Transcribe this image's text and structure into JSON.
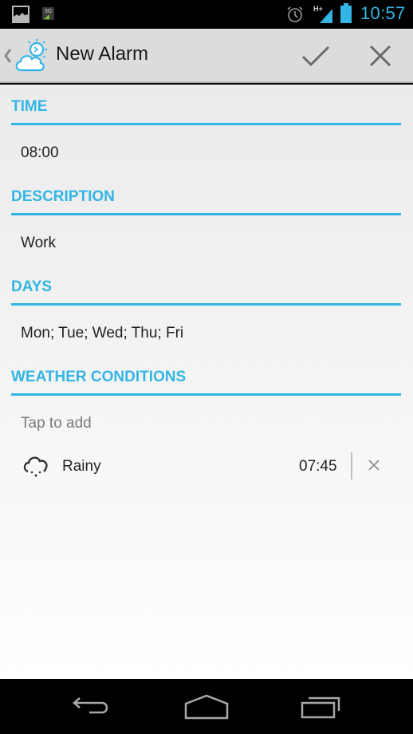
{
  "status_bar": {
    "icons": [
      "gallery-notification-icon",
      "3g-data-icon",
      "alarm-icon",
      "signal-hplus-icon",
      "battery-icon"
    ],
    "network_label": "H+",
    "data_label": "3G",
    "time": "10:57",
    "accent_color": "#33b5e5"
  },
  "action_bar": {
    "up_icon": "chevron-left-icon",
    "logo_icon": "weather-alarm-logo-icon",
    "title": "New Alarm",
    "confirm_icon": "check-icon",
    "cancel_icon": "close-icon"
  },
  "form": {
    "accent_color": "#33b5e5",
    "sections": [
      {
        "header": "TIME",
        "value": "08:00"
      },
      {
        "header": "DESCRIPTION",
        "value": "Work"
      },
      {
        "header": "DAYS",
        "value": "Mon; Tue; Wed; Thu; Fri"
      },
      {
        "header": "WEATHER CONDITIONS",
        "placeholder": "Tap to add"
      }
    ],
    "conditions": [
      {
        "icon": "rain-cloud-icon",
        "name": "Rainy",
        "time": "07:45",
        "remove_icon": "close-icon"
      }
    ]
  },
  "nav_bar": {
    "back_icon": "back-icon",
    "home_icon": "home-icon",
    "recents_icon": "recent-apps-icon"
  }
}
